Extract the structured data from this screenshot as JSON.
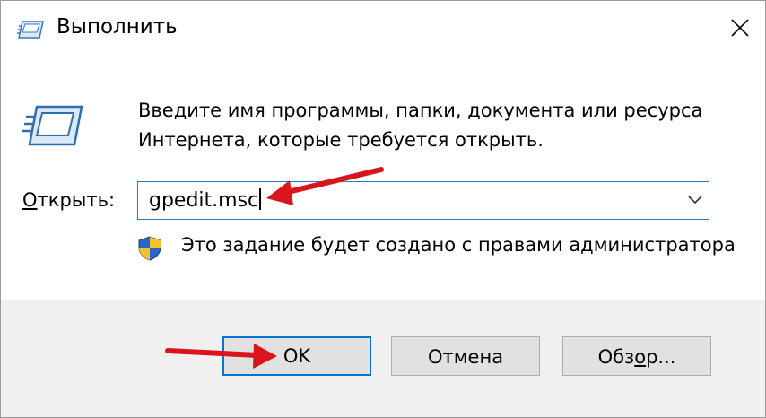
{
  "window": {
    "title": "Выполнить",
    "close_glyph": "✕"
  },
  "dialog": {
    "description_line1": "Введите имя программы, папки, документа или ресурса",
    "description_line2": "Интернета, которые требуется открыть.",
    "open_label_accel": "О",
    "open_label_rest": "ткрыть:",
    "input_value": "gpedit.msc",
    "admin_notice": "Это задание будет создано с правами администратора"
  },
  "buttons": {
    "ok": "OK",
    "cancel": "Отмена",
    "browse_pre": "Обз",
    "browse_accel": "о",
    "browse_post": "р..."
  },
  "colors": {
    "accent": "#1e7ad2",
    "annotation_arrow": "#e01b24",
    "footer_bg": "#f0f0f0"
  },
  "icons": [
    "run-icon",
    "close-icon",
    "run-large-icon",
    "chevron-down-icon",
    "uac-shield-icon",
    "annotation-arrow"
  ]
}
